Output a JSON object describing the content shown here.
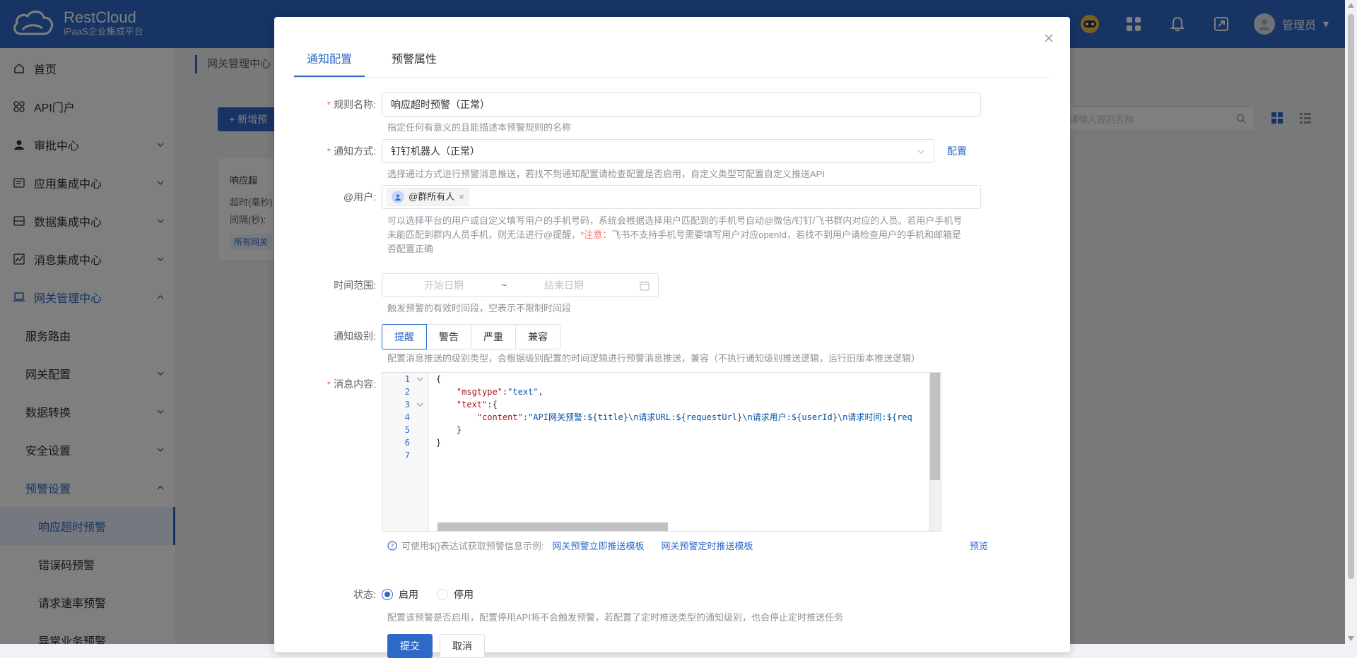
{
  "app": {
    "name": "RestCloud",
    "subtitle": "iPaaS企业集成平台",
    "user": "管理员"
  },
  "sidebar": {
    "items": [
      {
        "label": "首页"
      },
      {
        "label": "API门户"
      },
      {
        "label": "审批中心"
      },
      {
        "label": "应用集成中心"
      },
      {
        "label": "数据集成中心"
      },
      {
        "label": "消息集成中心"
      },
      {
        "label": "网关管理中心"
      },
      {
        "label": "服务路由"
      },
      {
        "label": "网关配置"
      },
      {
        "label": "数据转换"
      },
      {
        "label": "安全设置"
      },
      {
        "label": "预警设置"
      },
      {
        "label": "响应超时预警"
      },
      {
        "label": "错误码预警"
      },
      {
        "label": "请求速率预警"
      },
      {
        "label": "异常业务预警"
      }
    ]
  },
  "background": {
    "breadcrumb": "网关管理中心",
    "add_button": "+ 新增预",
    "search_placeholder": "请输入规则名称",
    "card": {
      "title": "响应超",
      "line1": "超时(毫秒)",
      "line2": "间隔(秒):",
      "tag": "所有网关"
    }
  },
  "modal": {
    "tabs": [
      {
        "label": "通知配置"
      },
      {
        "label": "预警属性"
      }
    ],
    "rule_name": {
      "label": "规则名称:",
      "value": "响应超时预警（正常）",
      "help": "指定任何有意义的且能描述本预警规则的名称"
    },
    "notify_method": {
      "label": "通知方式:",
      "value": "钉钉机器人（正常）",
      "config_link": "配置",
      "help": "选择通过方式进行预警消息推送，若找不到通知配置请检查配置是否启用，自定义类型可配置自定义推送API"
    },
    "at_user": {
      "label": "@用户:",
      "tag": "@群所有人",
      "help_1": "可以选择平台的用户或自定义填写用户的手机号码，系统会根据选择用户匹配到的手机号自动@微信/钉钉/飞书群内对应的人员。若用户手机号",
      "help_2a": "未能匹配到群内人员手机，则无法进行@提醒，",
      "help_2b": "*注意：",
      "help_2c": "飞书不支持手机号需要填写用户对应openId，若找不到用户请检查用户的手机和邮箱是",
      "help_3": "否配置正确"
    },
    "time_range": {
      "label": "时间范围:",
      "start_placeholder": "开始日期",
      "separator": "~",
      "end_placeholder": "结束日期",
      "help": "触发预警的有效时间段，空表示不限制时间段"
    },
    "notify_level": {
      "label": "通知级别:",
      "options": [
        "提醒",
        "警告",
        "严重",
        "兼容"
      ],
      "selected": "提醒",
      "help": "配置消息推送的级别类型，会根据级别配置的时间逻辑进行预警消息推送，兼容（不执行通知级别推送逻辑，运行旧版本推送逻辑）"
    },
    "message": {
      "label": "消息内容:",
      "line_numbers": [
        "1",
        "2",
        "3",
        "4",
        "5",
        "6",
        "7"
      ],
      "code": {
        "l1": "{",
        "l2_key": "\"msgtype\"",
        "l2_val": "\"text\"",
        "l3_key": "\"text\"",
        "l3_rest": ":{",
        "l4_key": "\"content\"",
        "l4_val": "\"API网关预警:${title}\\n请求URL:${requestUrl}\\n请求用户:${userId}\\n请求时间:${req",
        "l5": "}",
        "l6": "}"
      },
      "hint": "可使用${}表达试获取预警信息示例:",
      "template_1": "网关预警立即推送模板",
      "template_2": "网关预警定时推送模板",
      "preview": "预览"
    },
    "status": {
      "label": "状态:",
      "enabled": "启用",
      "disabled": "停用",
      "selected": "启用",
      "help": "配置该预警是否启用，配置停用API将不会触发预警，若配置了定时推送类型的通知级别，也会停止定时推送任务"
    },
    "submit": "提交",
    "cancel": "取消"
  },
  "colors": {
    "primary": "#2e69c9",
    "required": "#f56c6c"
  }
}
